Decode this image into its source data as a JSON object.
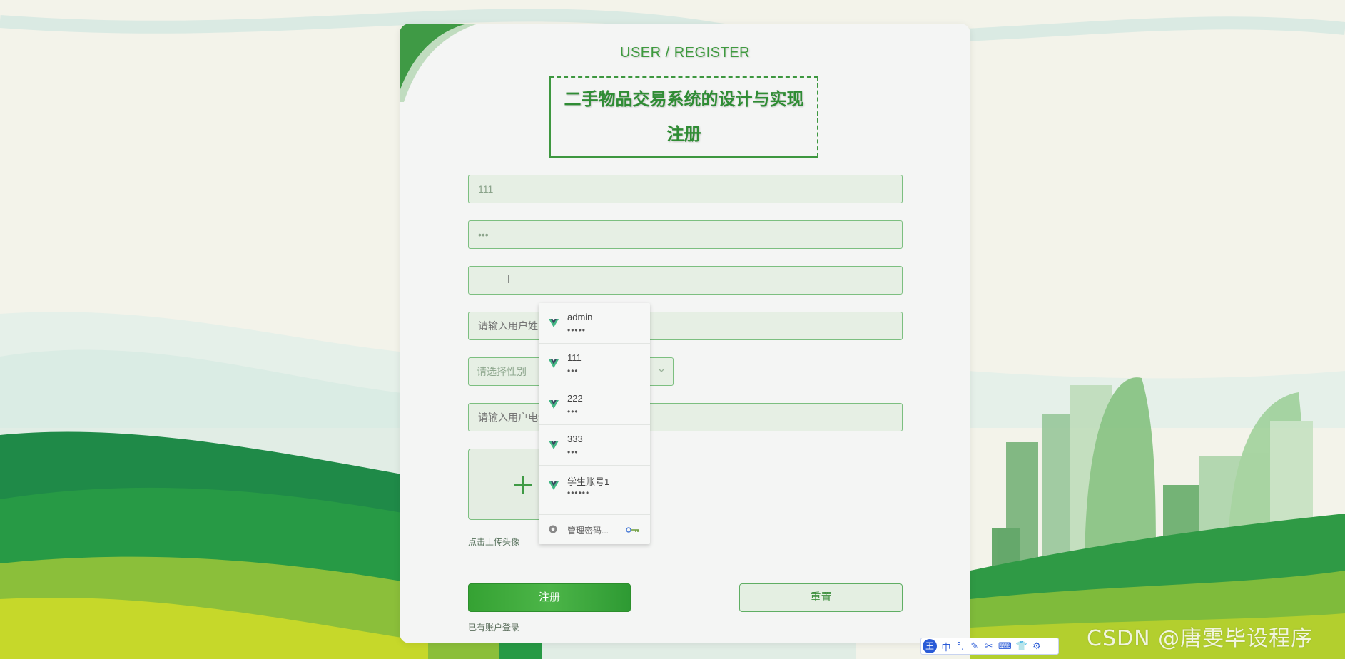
{
  "header": {
    "subtitle": "USER / REGISTER",
    "title_line1": "二手物品交易系统的设计与实现",
    "title_line2": "注册"
  },
  "form": {
    "username_value": "111",
    "password_value": "•••",
    "confirm_value": "",
    "name_placeholder": "请输入用户姓名",
    "gender_placeholder": "请选择性别",
    "phone_placeholder": "请输入用户电话",
    "upload_label": "点击上传头像"
  },
  "buttons": {
    "register": "注册",
    "reset": "重置",
    "login_link": "已有账户登录"
  },
  "autofill": {
    "items": [
      {
        "user": "admin",
        "pass": "•••••"
      },
      {
        "user": "111",
        "pass": "•••"
      },
      {
        "user": "222",
        "pass": "•••"
      },
      {
        "user": "333",
        "pass": "•••"
      },
      {
        "user": "学生账号1",
        "pass": "••••••"
      }
    ],
    "manage": "管理密码..."
  },
  "ime": {
    "logo": "王",
    "mode": "中",
    "icons": [
      "punct-icon",
      "pen-icon",
      "scissors-icon",
      "keyboard-icon",
      "shirt-icon",
      "gear-icon"
    ]
  },
  "watermark": "CSDN @唐雯毕设程序",
  "colors": {
    "brand_green": "#3d973f",
    "button_green": "#35a233",
    "field_bg": "#e6efe4"
  }
}
